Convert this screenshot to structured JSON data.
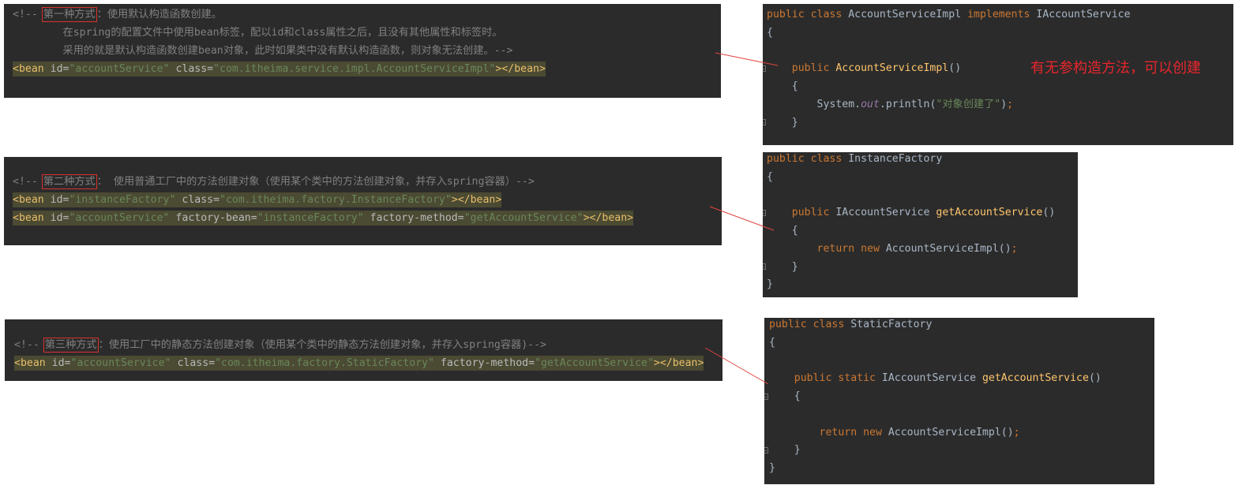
{
  "theme": {
    "page_background": "#ffffff",
    "editor_background": "#2b2b2b",
    "plain": "#a9b7c6",
    "keyword": "#cc7832",
    "method": "#ffc66d",
    "field": "#9876aa",
    "string": "#6a8759",
    "comment": "#808080",
    "tag": "#e8bf6a",
    "attr": "#bababa",
    "value": "#6a8759",
    "selection": "#4b4a33",
    "box_border": "#d8322e",
    "annotation_red": "#e8262c",
    "connector_red": "#e0443f",
    "gutter_marker": "#6e6e6e"
  },
  "xml_panels": [
    {
      "lines": [
        {
          "tokens": [
            {
              "comment": "<!-- "
            },
            {
              "boxed": "第一种方式"
            },
            {
              "comment": "：使用默认构造函数创建。"
            }
          ]
        },
        {
          "tokens": [
            {
              "comment": "        在spring的配置文件中使用bean标签，配以id和class属性之后，且没有其他属性和标签时。"
            }
          ]
        },
        {
          "tokens": [
            {
              "comment": "        采用的就是默认构造函数创建bean对象，此时如果类中没有默认构造函数，则对象无法创建。-->"
            }
          ]
        },
        {
          "selected": true,
          "tokens": [
            {
              "tag": "<bean "
            },
            {
              "attr": "id="
            },
            {
              "value": "\"accountService\""
            },
            {
              "attr": " class="
            },
            {
              "value": "\"com.itheima.service.impl.AccountServiceImpl\""
            },
            {
              "tag": "></bean>"
            }
          ]
        }
      ]
    },
    {
      "lines": [
        {
          "tokens": [
            {
              "comment": "<!-- "
            },
            {
              "boxed": "第二种方式"
            },
            {
              "comment": "： 使用普通工厂中的方法创建对象（使用某个类中的方法创建对象，并存入spring容器）-->"
            }
          ]
        },
        {
          "selected": true,
          "tokens": [
            {
              "tag": "<bean "
            },
            {
              "attr": "id="
            },
            {
              "value": "\"instanceFactory\""
            },
            {
              "attr": " class="
            },
            {
              "value": "\"com.itheima.factory.InstanceFactory\""
            },
            {
              "tag": "></bean>"
            }
          ]
        },
        {
          "selected": true,
          "tokens": [
            {
              "tag": "<bean "
            },
            {
              "attr": "id="
            },
            {
              "value": "\"accountService\""
            },
            {
              "attr": " factory-bean="
            },
            {
              "value": "\"instanceFactory\""
            },
            {
              "attr": " factory-method="
            },
            {
              "value": "\"getAccountService\""
            },
            {
              "tag": "></bean>"
            }
          ]
        }
      ]
    },
    {
      "lines": [
        {
          "tokens": [
            {
              "comment": "<!-- "
            },
            {
              "boxed": "第三种方式"
            },
            {
              "comment": "：使用工厂中的静态方法创建对象（使用某个类中的静态方法创建对象，并存入spring容器)-->"
            }
          ]
        },
        {
          "selected": true,
          "tokens": [
            {
              "tag": "<bean "
            },
            {
              "attr": "id="
            },
            {
              "value": "\"accountService\""
            },
            {
              "attr": " class="
            },
            {
              "value": "\"com.itheima.factory.StaticFactory\""
            },
            {
              "attr": " factory-method="
            },
            {
              "value": "\"getAccountService\""
            },
            {
              "tag": "></bean>"
            }
          ]
        }
      ]
    }
  ],
  "java_panels": [
    {
      "lines": [
        {
          "tokens": [
            {
              "keyword": "public class "
            },
            {
              "plain": "AccountServiceImpl "
            },
            {
              "keyword": "implements "
            },
            {
              "plain": "IAccountService"
            }
          ]
        },
        {
          "tokens": [
            {
              "plain": "{"
            }
          ]
        },
        {
          "tokens": []
        },
        {
          "gutter_icon": "fold-marker-icon",
          "tokens": [
            {
              "keyword": "    public "
            },
            {
              "method": "AccountServiceImpl"
            },
            {
              "plain": "()"
            }
          ]
        },
        {
          "tokens": [
            {
              "plain": "    {"
            }
          ]
        },
        {
          "tokens": [
            {
              "plain": "        System."
            },
            {
              "field": "out"
            },
            {
              "plain": ".println("
            },
            {
              "string": "\"对象创建了\""
            },
            {
              "plain": ")"
            },
            {
              "keyword": ";"
            }
          ]
        },
        {
          "gutter_icon": "fold-marker-icon",
          "tokens": [
            {
              "plain": "    }"
            }
          ]
        }
      ]
    },
    {
      "lines": [
        {
          "tokens": [
            {
              "keyword": "public class "
            },
            {
              "plain": "InstanceFactory"
            }
          ]
        },
        {
          "tokens": [
            {
              "plain": "{"
            }
          ]
        },
        {
          "tokens": []
        },
        {
          "gutter_icon": "fold-marker-icon",
          "tokens": [
            {
              "keyword": "    public "
            },
            {
              "plain": "IAccountService "
            },
            {
              "method": "getAccountService"
            },
            {
              "plain": "()"
            }
          ]
        },
        {
          "tokens": [
            {
              "plain": "    {"
            }
          ]
        },
        {
          "tokens": [
            {
              "keyword": "        return new "
            },
            {
              "plain": "AccountServiceImpl()"
            },
            {
              "keyword": ";"
            }
          ]
        },
        {
          "gutter_icon": "fold-marker-icon",
          "tokens": [
            {
              "plain": "    }"
            }
          ]
        },
        {
          "tokens": [
            {
              "plain": "}"
            }
          ]
        }
      ]
    },
    {
      "lines": [
        {
          "tokens": [
            {
              "keyword": "public class "
            },
            {
              "plain": "StaticFactory"
            }
          ]
        },
        {
          "tokens": [
            {
              "plain": "{"
            }
          ]
        },
        {
          "tokens": []
        },
        {
          "tokens": [
            {
              "keyword": "    public static "
            },
            {
              "plain": "IAccountService "
            },
            {
              "method": "getAccountService"
            },
            {
              "plain": "()"
            }
          ]
        },
        {
          "gutter_icon": "fold-marker-icon",
          "tokens": [
            {
              "plain": "    {"
            }
          ]
        },
        {
          "tokens": []
        },
        {
          "tokens": [
            {
              "keyword": "        return new "
            },
            {
              "plain": "AccountServiceImpl()"
            },
            {
              "keyword": ";"
            }
          ]
        },
        {
          "gutter_icon": "fold-marker-icon",
          "tokens": [
            {
              "plain": "    }"
            }
          ]
        },
        {
          "tokens": [
            {
              "plain": "}"
            }
          ]
        }
      ]
    }
  ],
  "annotation": {
    "text": "有无参构造方法，可以创建"
  }
}
